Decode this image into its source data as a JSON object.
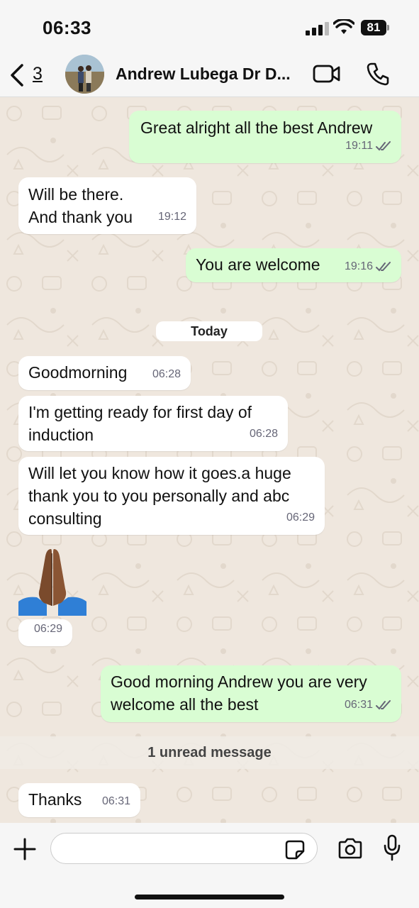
{
  "status_bar": {
    "time": "06:33",
    "battery": "81"
  },
  "header": {
    "back_count": "3",
    "contact_name": "Andrew Lubega Dr D..."
  },
  "messages": [
    {
      "direction": "out",
      "text": "Great alright all the best Andrew",
      "time": "19:11",
      "read": true
    },
    {
      "direction": "in",
      "text": "Will be there.\nAnd thank you",
      "time": "19:12"
    },
    {
      "direction": "out",
      "text": "You are welcome",
      "time": "19:16",
      "read": true
    },
    {
      "direction": "in",
      "text": "Goodmorning",
      "time": "06:28"
    },
    {
      "direction": "in",
      "text": "I'm getting ready for first day of induction",
      "time": "06:28"
    },
    {
      "direction": "in",
      "text": "Will let you know how it goes.a huge thank you to you personally and abc consulting",
      "time": "06:29"
    },
    {
      "direction": "in",
      "emoji": "folded-hands",
      "time": "06:29"
    },
    {
      "direction": "out",
      "text": "Good morning Andrew you are very welcome all the best",
      "time": "06:31",
      "read": true
    },
    {
      "direction": "in",
      "text": "Thanks",
      "time": "06:31"
    }
  ],
  "date_divider": "Today",
  "unread_banner": "1 unread message",
  "input": {
    "value": "",
    "placeholder": ""
  },
  "colors": {
    "outgoing_bubble": "#d9fdd3",
    "incoming_bubble": "#ffffff",
    "chat_background": "#efe7de",
    "read_ticks": "#53bdeb"
  }
}
